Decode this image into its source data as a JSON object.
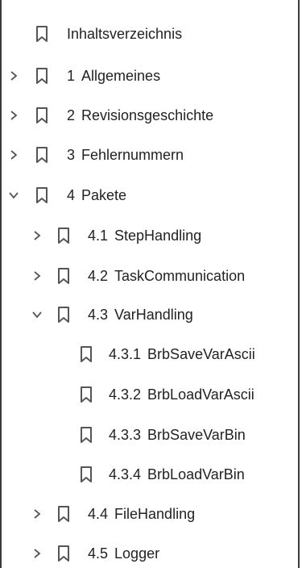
{
  "bookmarks": [
    {
      "number": "",
      "title": "Inhaltsverzeichnis",
      "expander": "none"
    },
    {
      "number": "1",
      "title": "Allgemeines",
      "expander": "collapsed"
    },
    {
      "number": "2",
      "title": "Revisionsgeschichte",
      "expander": "collapsed"
    },
    {
      "number": "3",
      "title": "Fehlernummern",
      "expander": "collapsed"
    },
    {
      "number": "4",
      "title": "Pakete",
      "expander": "expanded"
    },
    {
      "number": "4.1",
      "title": "StepHandling",
      "expander": "collapsed"
    },
    {
      "number": "4.2",
      "title": "TaskCommunication",
      "expander": "collapsed"
    },
    {
      "number": "4.3",
      "title": "VarHandling",
      "expander": "expanded"
    },
    {
      "number": "4.3.1",
      "title": "BrbSaveVarAscii",
      "expander": "none"
    },
    {
      "number": "4.3.2",
      "title": "BrbLoadVarAscii",
      "expander": "none"
    },
    {
      "number": "4.3.3",
      "title": "BrbSaveVarBin",
      "expander": "none"
    },
    {
      "number": "4.3.4",
      "title": "BrbLoadVarBin",
      "expander": "none"
    },
    {
      "number": "4.4",
      "title": "FileHandling",
      "expander": "collapsed"
    },
    {
      "number": "4.5",
      "title": "Logger",
      "expander": "collapsed"
    }
  ],
  "icons": {
    "bookmark": "bookmark-icon",
    "collapsed": "chevron-right-icon",
    "expanded": "chevron-down-icon"
  },
  "colors": {
    "icon": "#555555",
    "text": "#222222",
    "border": "#3a3a3a"
  }
}
